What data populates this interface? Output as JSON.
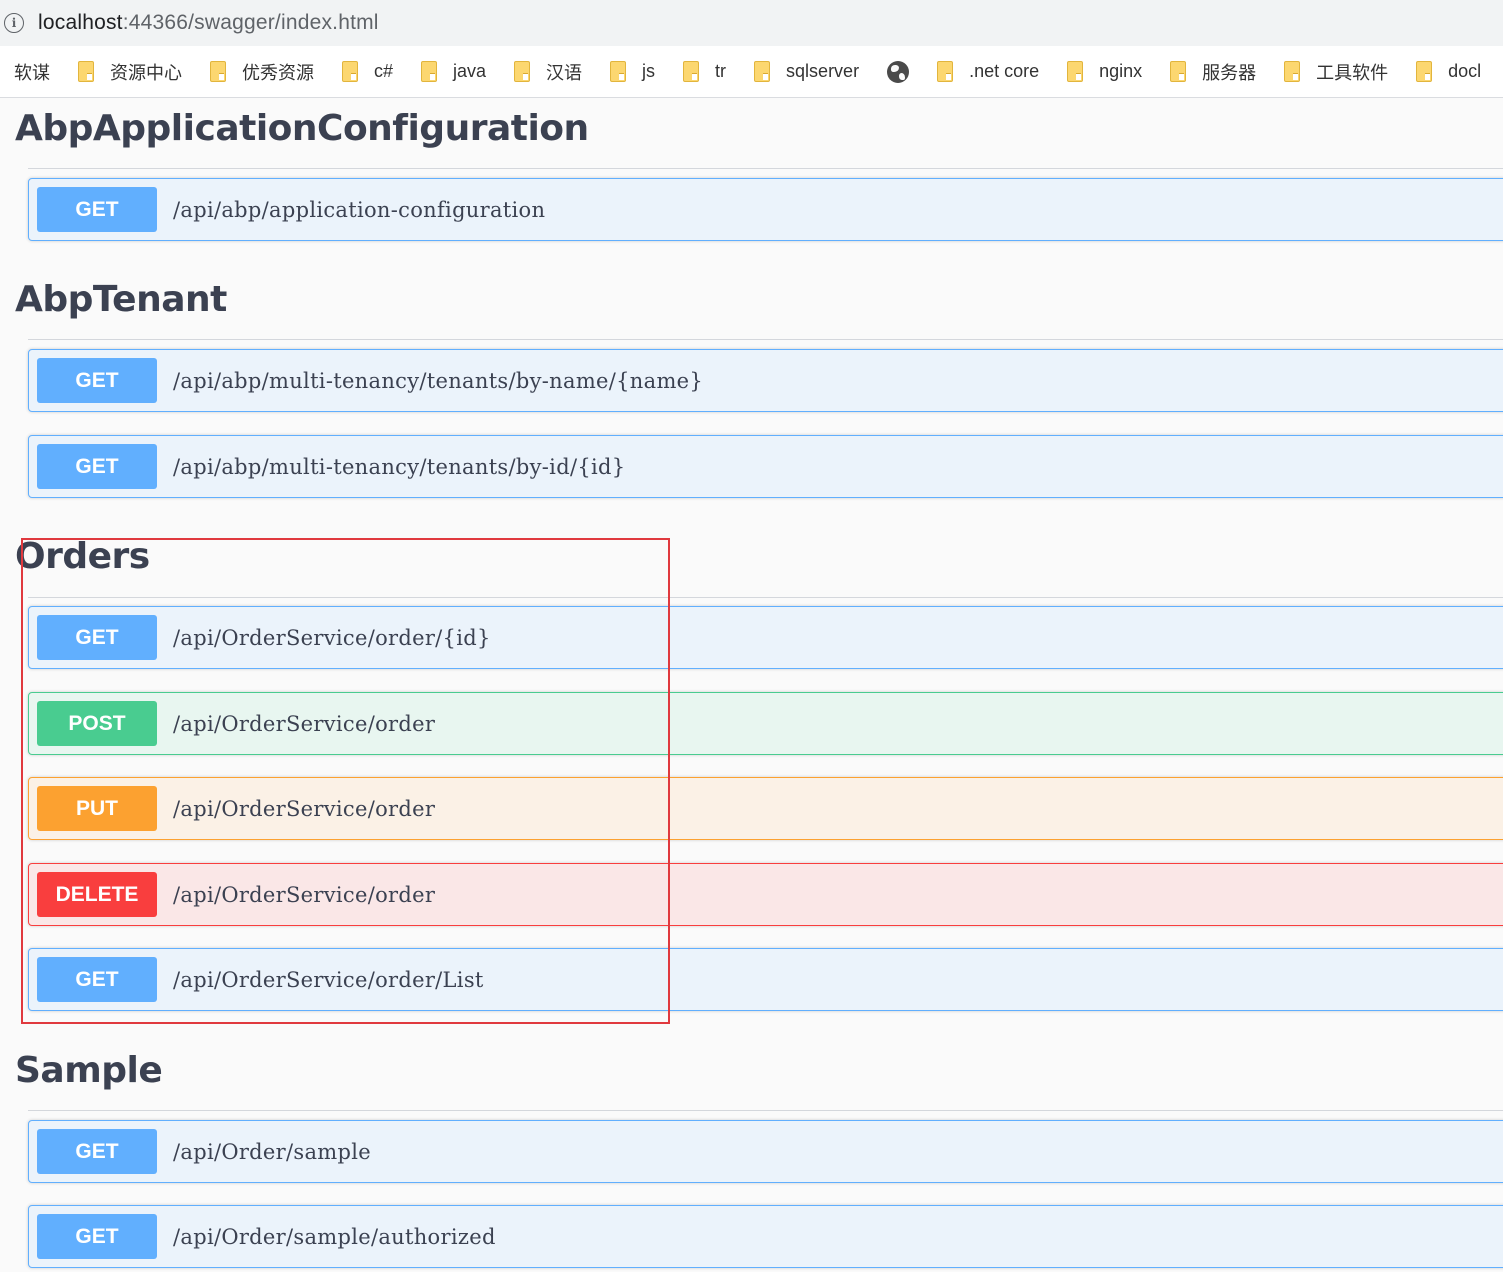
{
  "browser": {
    "url_host": "localhost",
    "url_rest": ":44366/swagger/index.html"
  },
  "bookmarks": [
    {
      "label": "软谋",
      "folder": false
    },
    {
      "label": "资源中心",
      "folder": true
    },
    {
      "label": "优秀资源",
      "folder": true
    },
    {
      "label": "c#",
      "folder": true
    },
    {
      "label": "java",
      "folder": true
    },
    {
      "label": "汉语",
      "folder": true
    },
    {
      "label": "js",
      "folder": true
    },
    {
      "label": "tr",
      "folder": true
    },
    {
      "label": "sqlserver",
      "folder": true
    },
    {
      "label": "",
      "folder": false,
      "icon": "globe-icon"
    },
    {
      "label": ".net core",
      "folder": true
    },
    {
      "label": "nginx",
      "folder": true
    },
    {
      "label": "服务器",
      "folder": true
    },
    {
      "label": "工具软件",
      "folder": true
    },
    {
      "label": "docl",
      "folder": true
    }
  ],
  "sections": {
    "abp_config": {
      "title": "AbpApplicationConfiguration",
      "ops": [
        {
          "method": "GET",
          "path": "/api/abp/application-configuration"
        }
      ]
    },
    "abp_tenant": {
      "title": "AbpTenant",
      "ops": [
        {
          "method": "GET",
          "path": "/api/abp/multi-tenancy/tenants/by-name/{name}"
        },
        {
          "method": "GET",
          "path": "/api/abp/multi-tenancy/tenants/by-id/{id}"
        }
      ]
    },
    "orders": {
      "title": "Orders",
      "ops": [
        {
          "method": "GET",
          "path": "/api/OrderService/order/{id}"
        },
        {
          "method": "POST",
          "path": "/api/OrderService/order"
        },
        {
          "method": "PUT",
          "path": "/api/OrderService/order"
        },
        {
          "method": "DELETE",
          "path": "/api/OrderService/order"
        },
        {
          "method": "GET",
          "path": "/api/OrderService/order/List"
        }
      ]
    },
    "sample": {
      "title": "Sample",
      "ops": [
        {
          "method": "GET",
          "path": "/api/Order/sample"
        },
        {
          "method": "GET",
          "path": "/api/Order/sample/authorized"
        }
      ]
    }
  },
  "colors": {
    "get": "#61affe",
    "post": "#49cc90",
    "put": "#fca130",
    "delete": "#f93e3e",
    "highlight": "#e0393e"
  }
}
